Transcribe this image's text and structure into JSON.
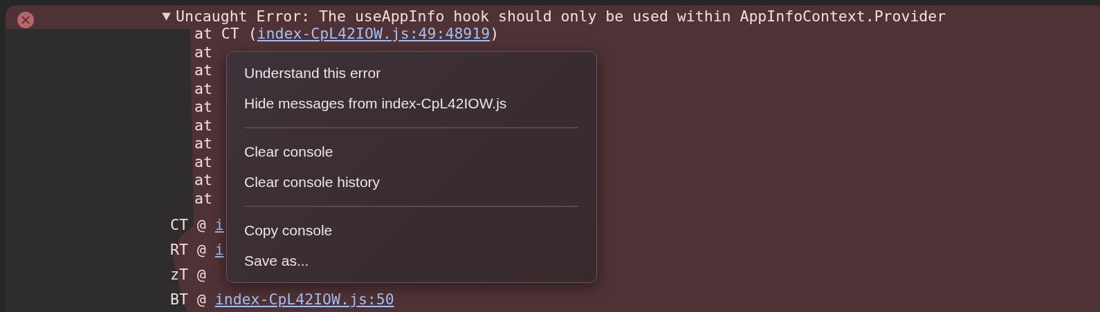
{
  "error": {
    "expanded": true,
    "message": "Uncaught Error: The useAppInfo hook should only be used within AppInfoContext.Provider",
    "stack": [
      {
        "text": "at CT (",
        "link": "index-CpL42IOW.js:49:48919",
        "suffix": ")"
      },
      {
        "text": "at"
      },
      {
        "text": "at"
      },
      {
        "text": "at"
      },
      {
        "text": "at"
      },
      {
        "text": "at"
      },
      {
        "text": "at"
      },
      {
        "text": "at"
      },
      {
        "text": "at"
      },
      {
        "text": "at"
      }
    ]
  },
  "sources": [
    {
      "text": "CT @",
      "link": "i"
    },
    {
      "text": "RT @",
      "link": "i"
    },
    {
      "text": "zT @"
    },
    {
      "text": "BT @",
      "link": "index-CpL42IOW.js:50"
    }
  ],
  "context_menu": {
    "groups": [
      [
        "Understand this error",
        "Hide messages from index-CpL42IOW.js"
      ],
      [
        "Clear console",
        "Clear console history"
      ],
      [
        "Copy console",
        "Save as..."
      ]
    ]
  }
}
